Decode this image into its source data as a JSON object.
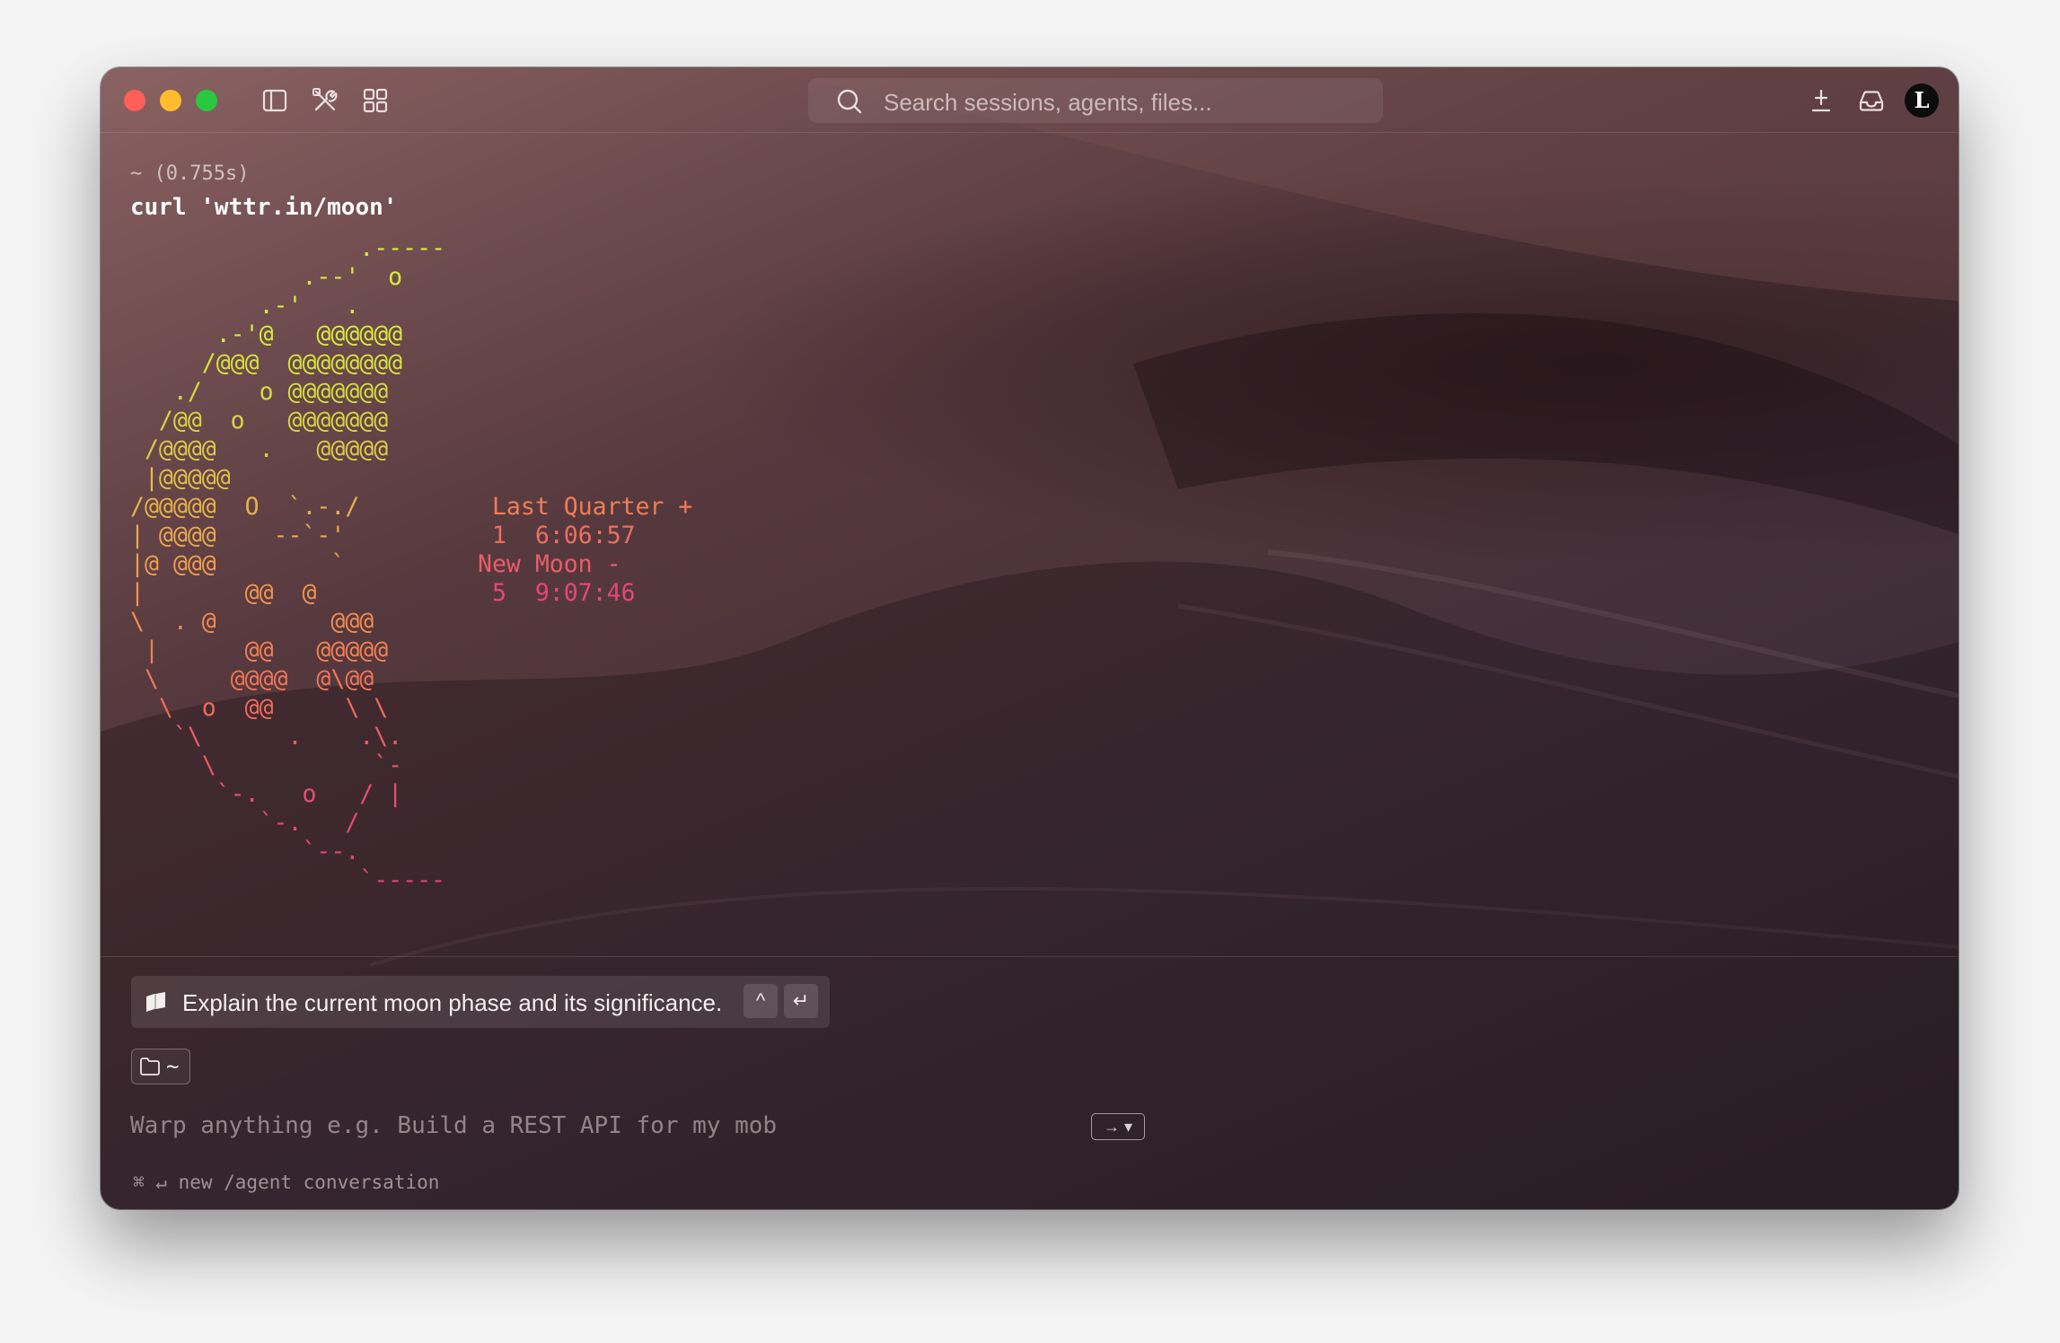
{
  "window": {
    "search_placeholder": "Search sessions, agents, files...",
    "avatar_letter": "L",
    "icons": [
      "sidebar-toggle-icon",
      "tools-icon",
      "grid-icon",
      "search-icon",
      "download-icon",
      "inbox-icon"
    ]
  },
  "terminal": {
    "block_meta": "~ (0.755s)",
    "command": "curl 'wttr.in/moon'",
    "moon_lines": [
      {
        "text": "                .-----",
        "color": "#d6ea3c"
      },
      {
        "text": "            .--'  o",
        "color": "#d6ea3c"
      },
      {
        "text": "         .-'   .",
        "color": "#d6ea3c"
      },
      {
        "text": "      .-'@   @@@@@@",
        "color": "#d6ea3c"
      },
      {
        "text": "     /@@@  @@@@@@@@",
        "color": "#d3e23e"
      },
      {
        "text": "   ./    o @@@@@@@",
        "color": "#d2dc40"
      },
      {
        "text": "  /@@  o   @@@@@@@",
        "color": "#d8d444"
      },
      {
        "text": " /@@@@   .   @@@@@",
        "color": "#ddca46"
      },
      {
        "text": " |@@@@@",
        "color": "#e0bf48"
      },
      {
        "text": "/@@@@@  O  `.-./",
        "color": "#e6b24a"
      },
      {
        "text": "| @@@@    --`-'",
        "color": "#e9a84c"
      },
      {
        "text": "|@ @@@        `",
        "color": "#ec9d4e"
      },
      {
        "text": "|       @@  @",
        "color": "#ef9450"
      },
      {
        "text": "\\  . @        @@@",
        "color": "#f18b52"
      },
      {
        "text": " |      @@   @@@@@",
        "color": "#f18054"
      },
      {
        "text": " \\     @@@@  @\\@@",
        "color": "#f07456"
      },
      {
        "text": "  \\  o  @@     \\ \\",
        "color": "#ee6a5c"
      },
      {
        "text": "   `\\      .    .\\.",
        "color": "#ec5f62"
      },
      {
        "text": "     \\           `-",
        "color": "#ea5668"
      },
      {
        "text": "      `-.   o   / |",
        "color": "#e84e70"
      },
      {
        "text": "         `-.   /",
        "color": "#e64878"
      },
      {
        "text": "            `--.",
        "color": "#e4437e"
      },
      {
        "text": "                `-----",
        "color": "#e24084"
      }
    ],
    "phase_lines": [
      {
        "text": " Last Quarter +",
        "color": "#f07d56"
      },
      {
        "text": " 1  6:06:57",
        "color": "#ef6e5c"
      },
      {
        "text": "New Moon -",
        "color": "#ea5c68"
      },
      {
        "text": " 5  9:07:46",
        "color": "#e5467c"
      }
    ]
  },
  "input_area": {
    "suggestion_text": "Explain the current moon phase and its significance.",
    "suggestion_key_1": "^",
    "suggestion_key_2": "↵",
    "directory": "~",
    "prompt_placeholder": "Warp anything e.g. Build a REST API for my mobile app using FastAPI",
    "mode_chip": "→ ▾",
    "hint": "⌘ ↵ new /agent conversation"
  },
  "colors": {
    "accent_yellow": "#d6ea3c",
    "accent_orange": "#f18b52",
    "accent_pink": "#e24084",
    "traffic_red": "#ff5f57",
    "traffic_yellow": "#febc2e",
    "traffic_green": "#28c840"
  }
}
